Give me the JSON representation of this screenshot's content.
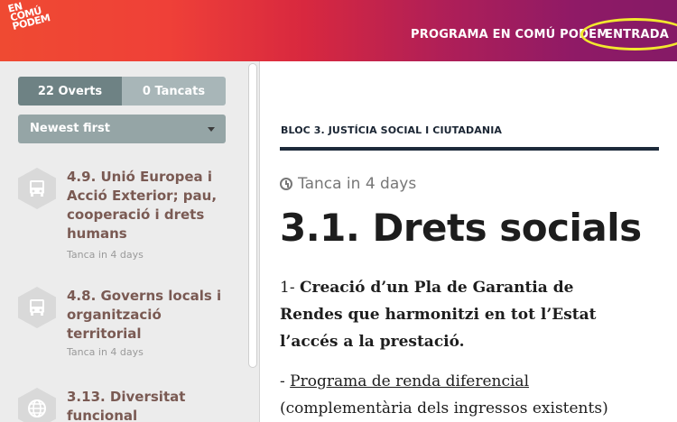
{
  "header": {
    "logo_lines": [
      "EN",
      "COMÚ",
      "PODEM"
    ],
    "nav_program": "PROGRAMA EN COMÚ PODEM",
    "nav_login": "ENTRADA",
    "highlight_color": "#f2e82e"
  },
  "sidebar": {
    "toggle": {
      "open_label": "22 Overts",
      "closed_label": "0 Tancats"
    },
    "sort": {
      "selected": "Newest first"
    },
    "items": [
      {
        "icon": "bus-icon",
        "title": "4.9. Unió Europea i Acció Exterior; pau, cooperació i drets humans",
        "meta": "Tanca in 4 days"
      },
      {
        "icon": "bus-icon",
        "title": "4.8. Governs locals i organització territorial",
        "meta": "Tanca in 4 days"
      },
      {
        "icon": "globe-icon",
        "title": "3.13. Diversitat funcional",
        "meta": ""
      }
    ]
  },
  "main": {
    "block_label": "BLOC 3. JUSTÍCIA SOCIAL I CIUTADANIA",
    "closing": "Tanca in 4 days",
    "title": "3.1. Drets socials",
    "p1_prefix": "1- ",
    "p1_bold": "Creació d’un Pla de Garantia de Rendes que harmonitzi en tot l’Estat l’accés a la prestació.",
    "p2_prefix": "- ",
    "p2_link": "Programa de renda diferencial",
    "p2_rest": " (complementària dels ingressos existents)"
  },
  "colors": {
    "accent_orange": "#ef4a32",
    "accent_purple": "#851a66",
    "item_title": "#7a5a53"
  }
}
